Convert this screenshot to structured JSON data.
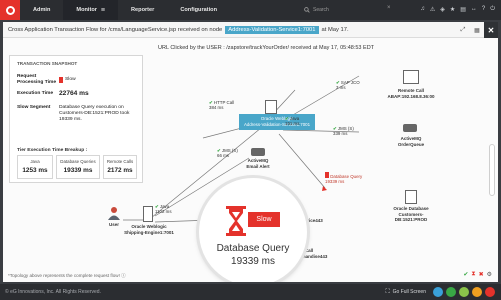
{
  "nav": {
    "items": [
      {
        "label": "Admin"
      },
      {
        "label": "Monitor"
      },
      {
        "label": "Reporter"
      },
      {
        "label": "Configuration"
      }
    ],
    "search_placeholder": "Search",
    "search_close": "×"
  },
  "window": {
    "title_prefix": "Cross Application Transaction Flow for /cms/LanguageService.jsp received on node",
    "node_name": "Address-Validation-Service1:7001",
    "title_suffix": "at May 17."
  },
  "canvas": {
    "url_line": "URL Clicked by the USER : /zapstore/trackYourOrder/ received at May 17, 05:48:53 EDT",
    "footnote": "*Topology above represents the complete request flow!"
  },
  "snapshot": {
    "title": "TRANSACTION SNAPSHOT",
    "request_time_label": "Request Processing Time",
    "request_time_value": "Slow",
    "exec_time_label": "Execution Time",
    "exec_time_value": "22764 ms",
    "slow_segment_label": "Slow Segment",
    "slow_segment_value": "Database Query execution on Customers-DB:1521:PROD took 19339 ms.",
    "tier_title": "Tier Execution Time Breakup :",
    "tiers": [
      {
        "label": "Java",
        "value": "1253 ms"
      },
      {
        "label": "Database Queries",
        "value": "19339 ms"
      },
      {
        "label": "Remote Calls",
        "value": "2172 ms"
      }
    ]
  },
  "flow": {
    "user_label": "User",
    "weblogic_left": "Oracle Weblogic\nShipping-Engine1:7001",
    "weblogic_center": "Oracle Weblogic\nAddress-Validation-Service1:7001",
    "remote_cat": "Remote Call\nABAP:192.168.8.36:00",
    "activemq_order": "ActiveMQ\nOrderQueue",
    "activemq_email": "ActiveMQ\nEmail Alert",
    "oracle_db": "Oracle Database\nCustomers-DB:1521:PROD",
    "service443": "Service443",
    "dcall": "Call\n:merchandise443",
    "edges": {
      "java_left": "Java\n1102 ms",
      "java_top": "Java\n151 ms",
      "http_call": "HTTP Call\n384 ms",
      "sap_jco": "SAP JCO\n3 ms",
      "jms_right": "JMS (S)\n339 ms",
      "jms_left": "JMS (S)\n66 ms",
      "db_query": "Database Query\n19339 ms"
    }
  },
  "magnifier": {
    "badge": "Slow",
    "name": "Database Query",
    "ms": "19339 ms"
  },
  "statusbar": {
    "copyright": "© eG Innovations, Inc. All Rights Reserved.",
    "fullscreen": "Go Full Screen"
  },
  "colors": {
    "brand_red": "#e4322b",
    "node_blue": "#49a6c9",
    "ok_green": "#39a845"
  }
}
